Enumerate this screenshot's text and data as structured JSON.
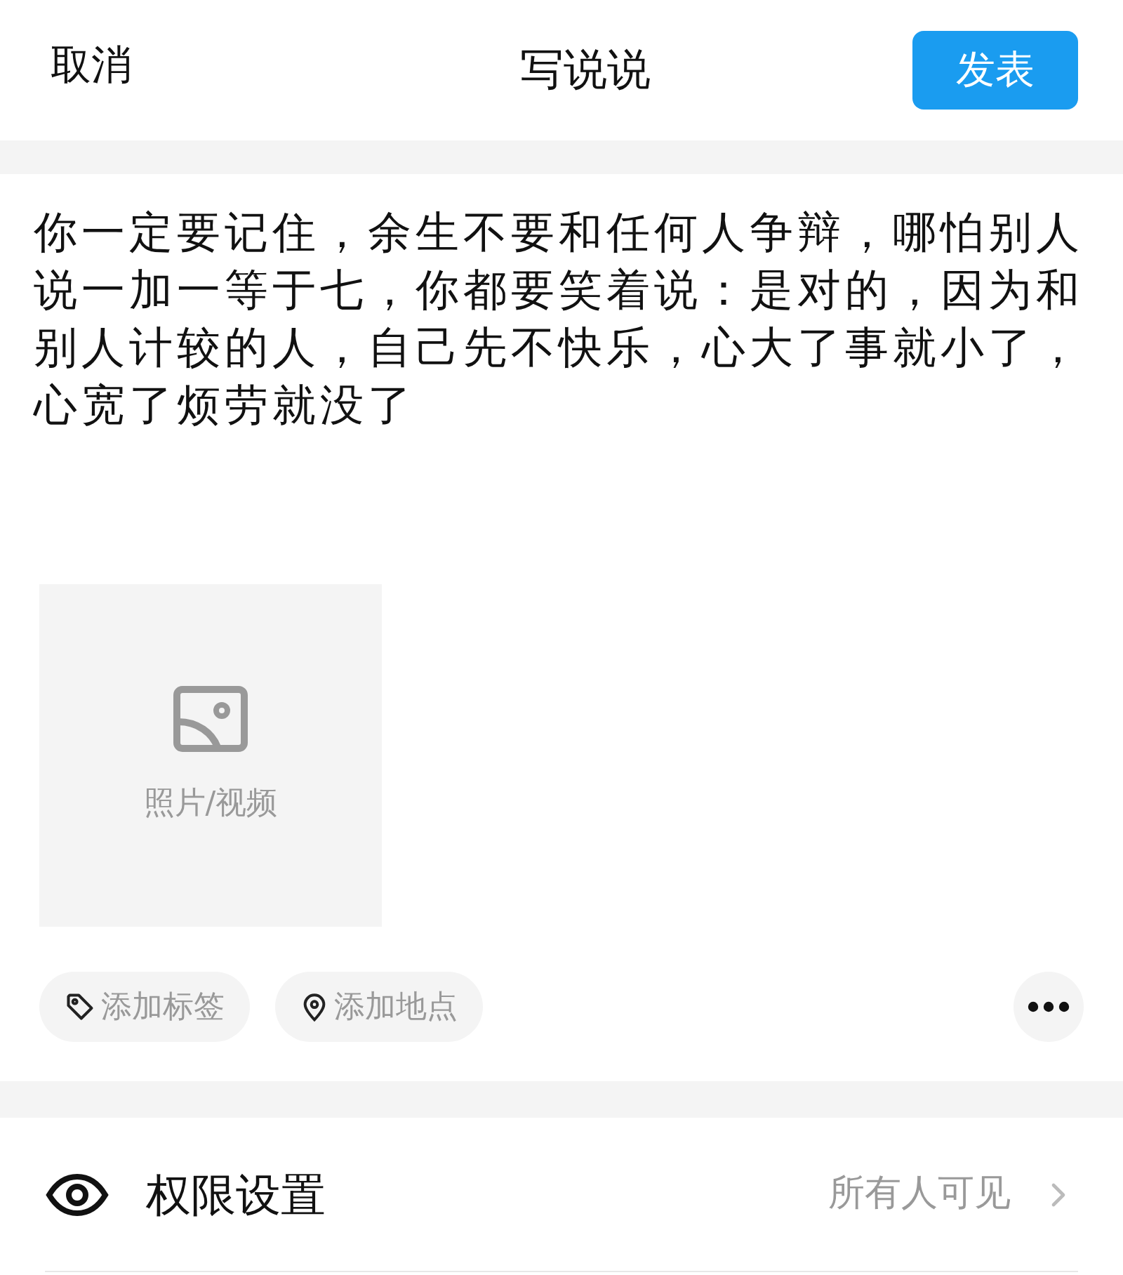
{
  "header": {
    "cancel": "取消",
    "title": "写说说",
    "publish": "发表"
  },
  "content": "你一定要记住，余生不要和任何人争辩，哪怕别人说一加一等于七，你都要笑着说：是对的，因为和别人计较的人，自己先不快乐，心大了事就小了，心宽了烦劳就没了",
  "media_picker": {
    "label": "照片/视频"
  },
  "chips": [
    {
      "kind": "tag",
      "label": "添加标签"
    },
    {
      "kind": "location",
      "label": "添加地点"
    }
  ],
  "permission": {
    "label": "权限设置",
    "value": "所有人可见"
  }
}
